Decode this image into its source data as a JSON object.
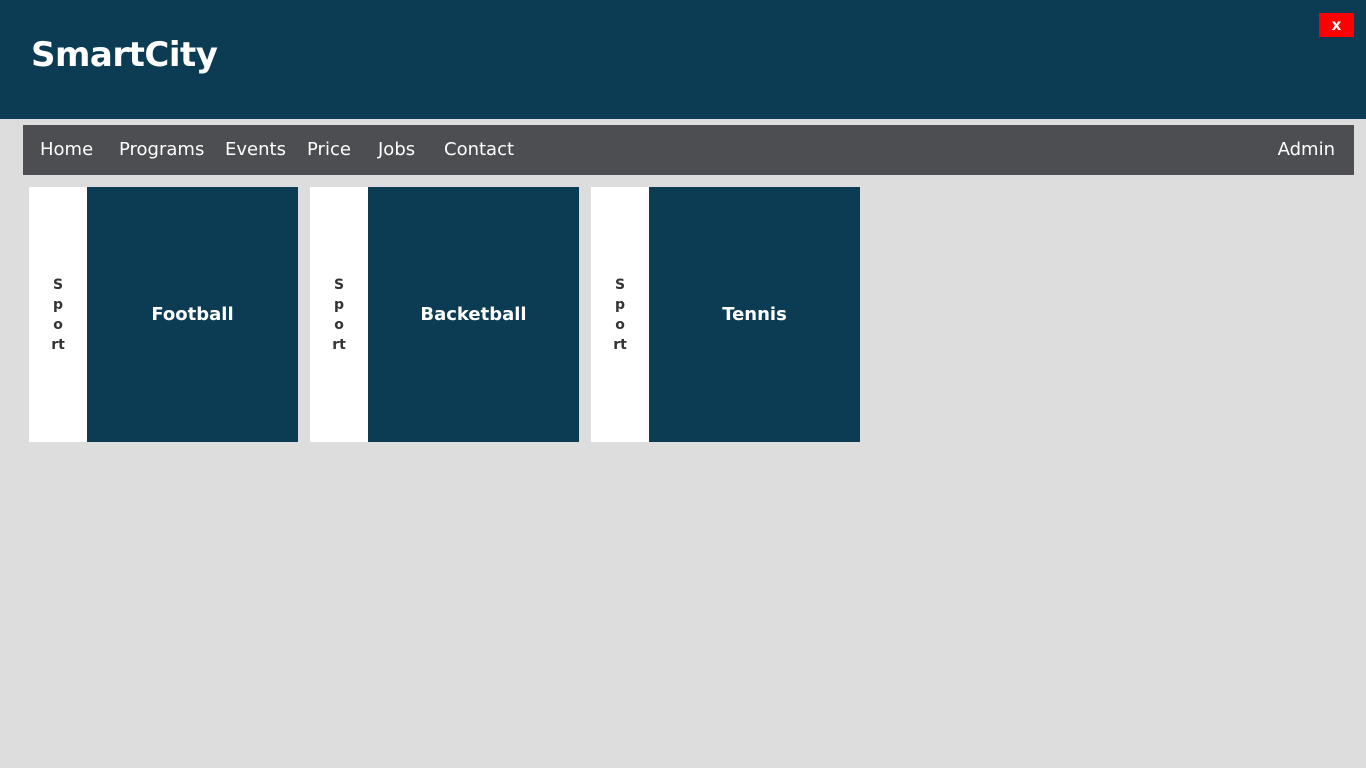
{
  "header": {
    "title": "SmartCity",
    "close_label": "x"
  },
  "nav": {
    "items": [
      {
        "label": "Home"
      },
      {
        "label": "Programs"
      },
      {
        "label": "Events"
      },
      {
        "label": "Price"
      },
      {
        "label": "Jobs"
      },
      {
        "label": "Contact"
      }
    ],
    "admin_label": "Admin"
  },
  "cards": [
    {
      "category": "Sport",
      "title": "Football"
    },
    {
      "category": "Sport",
      "title": "Backetball"
    },
    {
      "category": "Sport",
      "title": "Tennis"
    }
  ],
  "colors": {
    "header_bg": "#0b3c54",
    "nav_bg": "#4d4e52",
    "page_bg": "#dddddd",
    "card_bg": "#0b3c54",
    "close_bg": "#ff0000"
  }
}
